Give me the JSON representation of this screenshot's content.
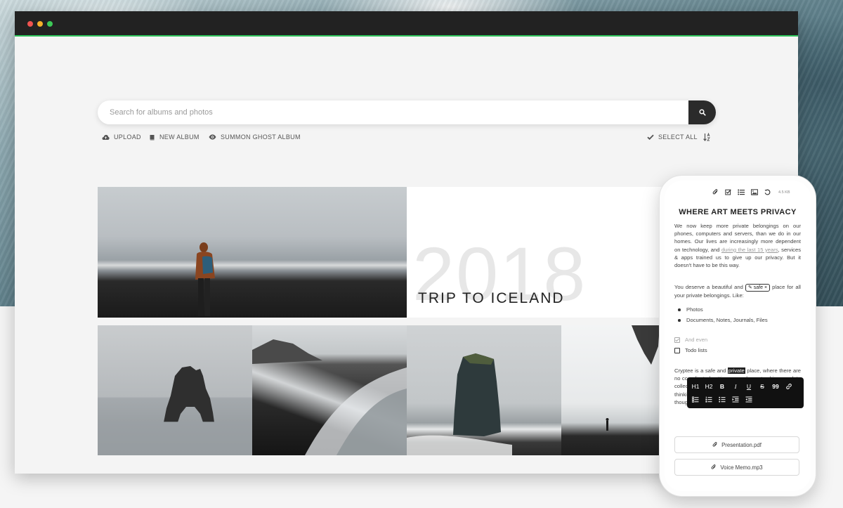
{
  "search": {
    "placeholder": "Search for albums and photos"
  },
  "toolbar": {
    "upload": "UPLOAD",
    "new_album": "NEW ALBUM",
    "ghost_album": "SUMMON GHOST ALBUM",
    "select_all": "SELECT ALL"
  },
  "album": {
    "year": "2018",
    "title": "TRIP TO ICELAND"
  },
  "phone": {
    "file_size": "4.5 KB",
    "title": "WHERE ART MEETS PRIVACY",
    "p1_a": "We now keep more private belongings on our phones, computers and servers, than we do in our homes. Our lives are increasingly more dependent on technology, and ",
    "p1_link": "during the last 15 years",
    "p1_b": ", services & apps trained us to give up our privacy. But it doesn't have to be this way.",
    "p2_a": "You deserve a beautiful and ",
    "p2_tag": "safe",
    "p2_b": " place for all your private belongings. Like:",
    "bullets": [
      "Photos",
      "Documents, Notes, Journals, Files"
    ],
    "check_done": "And even",
    "check_todo": "Todo lists",
    "p3_a": "Cryptee is a safe and ",
    "p3_highlight": "private",
    "p3_b": " place, where there are no complicated settings, no ads, no tracking, no data collected. It's a place to focus on your creativity and thinking. You and only you can easily put your thoughts, notes and files together.",
    "format": {
      "h1": "H1",
      "h2": "H2",
      "bold": "B",
      "italic": "I",
      "underline": "U",
      "strike": "S",
      "quote": "99"
    },
    "files": [
      "Presentation.pdf",
      "Voice Memo.mp3"
    ]
  }
}
